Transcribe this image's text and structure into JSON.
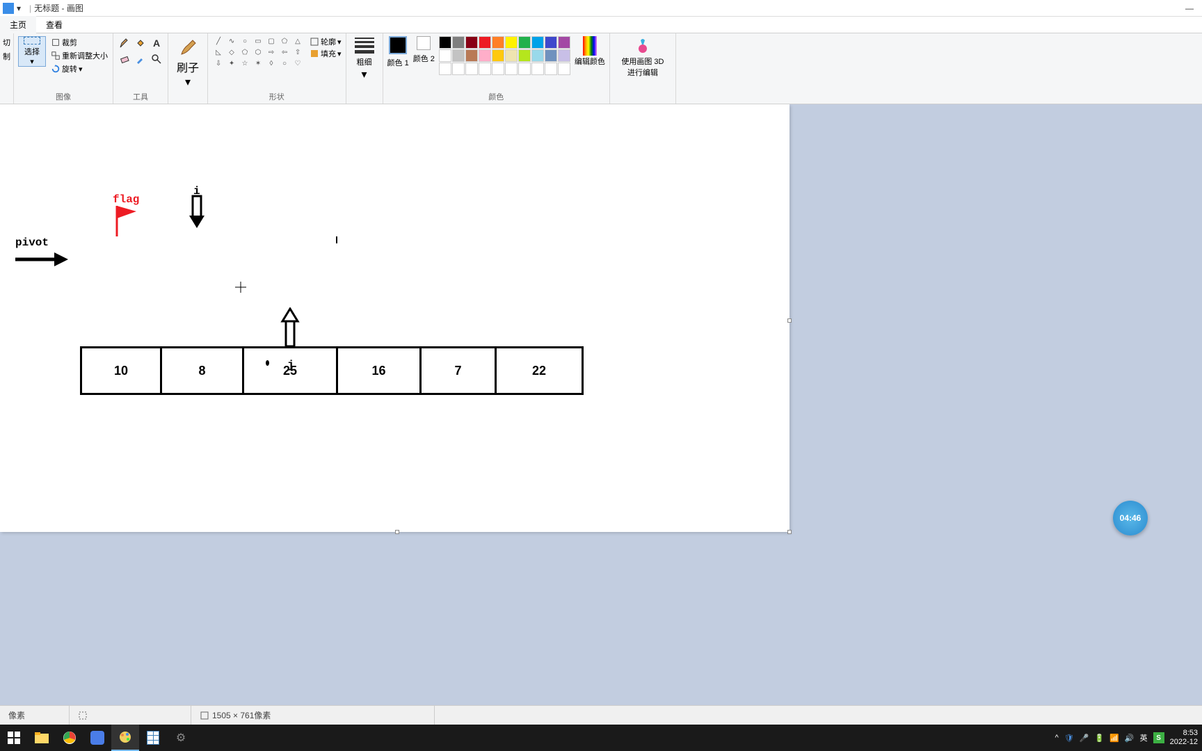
{
  "window": {
    "title": "无标题 - 画图",
    "minimize": "—",
    "qat_dropdown": "▾",
    "qat_sep": "|"
  },
  "tabs": {
    "home": "主页",
    "view": "查看"
  },
  "ribbon": {
    "clipboard": {
      "cut": "切",
      "copy": "制"
    },
    "selection": {
      "select": "选择",
      "select_arrow": "▾"
    },
    "image": {
      "label": "图像",
      "crop": "裁剪",
      "resize": "重新调整大小",
      "rotate": "旋转",
      "rotate_arrow": "▾"
    },
    "tools": {
      "label": "工具"
    },
    "brushes": {
      "label": "刷子",
      "arrow": "▾"
    },
    "shapes": {
      "label": "形状",
      "outline": "轮廓",
      "fill": "填充",
      "arrow": "▾"
    },
    "size": {
      "label": "粗细",
      "arrow": "▾"
    },
    "colors": {
      "label": "颜色",
      "color1": "颜色 1",
      "color2": "颜色 2",
      "edit_colors": "编辑颜色",
      "palette_row1": [
        "#000000",
        "#7f7f7f",
        "#880015",
        "#ed1c24",
        "#ff7f27",
        "#fff200",
        "#22b14c",
        "#00a2e8",
        "#3f48cc",
        "#a349a4"
      ],
      "palette_row2": [
        "#ffffff",
        "#c3c3c3",
        "#b97a57",
        "#ffaec9",
        "#ffc90e",
        "#efe4b0",
        "#b5e61d",
        "#99d9ea",
        "#7092be",
        "#c8bfe7"
      ],
      "palette_row3": [
        "#ffffff",
        "#ffffff",
        "#ffffff",
        "#ffffff",
        "#ffffff",
        "#ffffff",
        "#ffffff",
        "#ffffff",
        "#ffffff",
        "#ffffff"
      ]
    },
    "paint3d": {
      "label": "使用画图 3D 进行编辑"
    }
  },
  "canvas_content": {
    "pivot_label": "pivot",
    "flag_label": "flag",
    "i_label": "i",
    "j_label": "j",
    "array_values": [
      "10",
      "8",
      "25",
      "16",
      "7",
      "22"
    ]
  },
  "statusbar": {
    "pixels_suffix": "像素",
    "size": "1505 × 761像素"
  },
  "taskbar": {
    "time": "8:53",
    "date": "2022-12",
    "ime": "英"
  },
  "clock_widget": {
    "time": "04:46"
  },
  "ime_bar": {
    "lang": "英"
  }
}
